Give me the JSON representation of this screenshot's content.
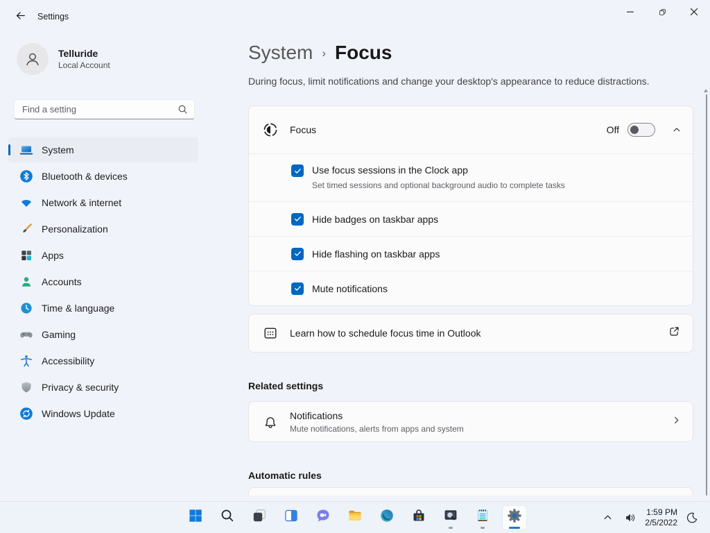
{
  "window": {
    "title": "Settings"
  },
  "account": {
    "name": "Telluride",
    "type": "Local Account"
  },
  "search": {
    "placeholder": "Find a setting"
  },
  "sidebar": {
    "items": [
      {
        "label": "System",
        "icon": "system-icon",
        "selected": true
      },
      {
        "label": "Bluetooth & devices",
        "icon": "bluetooth-icon"
      },
      {
        "label": "Network & internet",
        "icon": "network-icon"
      },
      {
        "label": "Personalization",
        "icon": "personalization-icon"
      },
      {
        "label": "Apps",
        "icon": "apps-icon"
      },
      {
        "label": "Accounts",
        "icon": "accounts-icon"
      },
      {
        "label": "Time & language",
        "icon": "time-language-icon"
      },
      {
        "label": "Gaming",
        "icon": "gaming-icon"
      },
      {
        "label": "Accessibility",
        "icon": "accessibility-icon"
      },
      {
        "label": "Privacy & security",
        "icon": "privacy-icon"
      },
      {
        "label": "Windows Update",
        "icon": "windows-update-icon"
      }
    ]
  },
  "breadcrumb": {
    "parent": "System",
    "separator": "›",
    "current": "Focus"
  },
  "page": {
    "description": "During focus, limit notifications and change your desktop's appearance to reduce distractions."
  },
  "focus": {
    "title": "Focus",
    "state_label": "Off",
    "options": [
      {
        "label": "Use focus sessions in the Clock app",
        "sub": "Set timed sessions and optional background audio to complete tasks",
        "checked": true
      },
      {
        "label": "Hide badges on taskbar apps",
        "checked": true
      },
      {
        "label": "Hide flashing on taskbar apps",
        "checked": true
      },
      {
        "label": "Mute notifications",
        "checked": true
      }
    ]
  },
  "outlook_link": {
    "label": "Learn how to schedule focus time in Outlook"
  },
  "related_settings": {
    "heading": "Related settings",
    "notifications": {
      "title": "Notifications",
      "subtitle": "Mute notifications, alerts from apps and system"
    }
  },
  "automatic_rules": {
    "heading": "Automatic rules"
  },
  "taskbar": {
    "icons": [
      "start-icon",
      "taskbar-search-icon",
      "task-view-icon",
      "widgets-icon",
      "chat-icon",
      "file-explorer-icon",
      "edge-icon",
      "store-icon",
      "log-search-icon",
      "notepad-icon",
      "settings-gear-icon"
    ],
    "tray": {
      "time": "1:59 PM",
      "date": "2/5/2022"
    }
  },
  "colors": {
    "accent": "#0067c0",
    "background": "#f0f3f9",
    "card": "#fbfbfc",
    "taskbar": "#eef2f9"
  }
}
